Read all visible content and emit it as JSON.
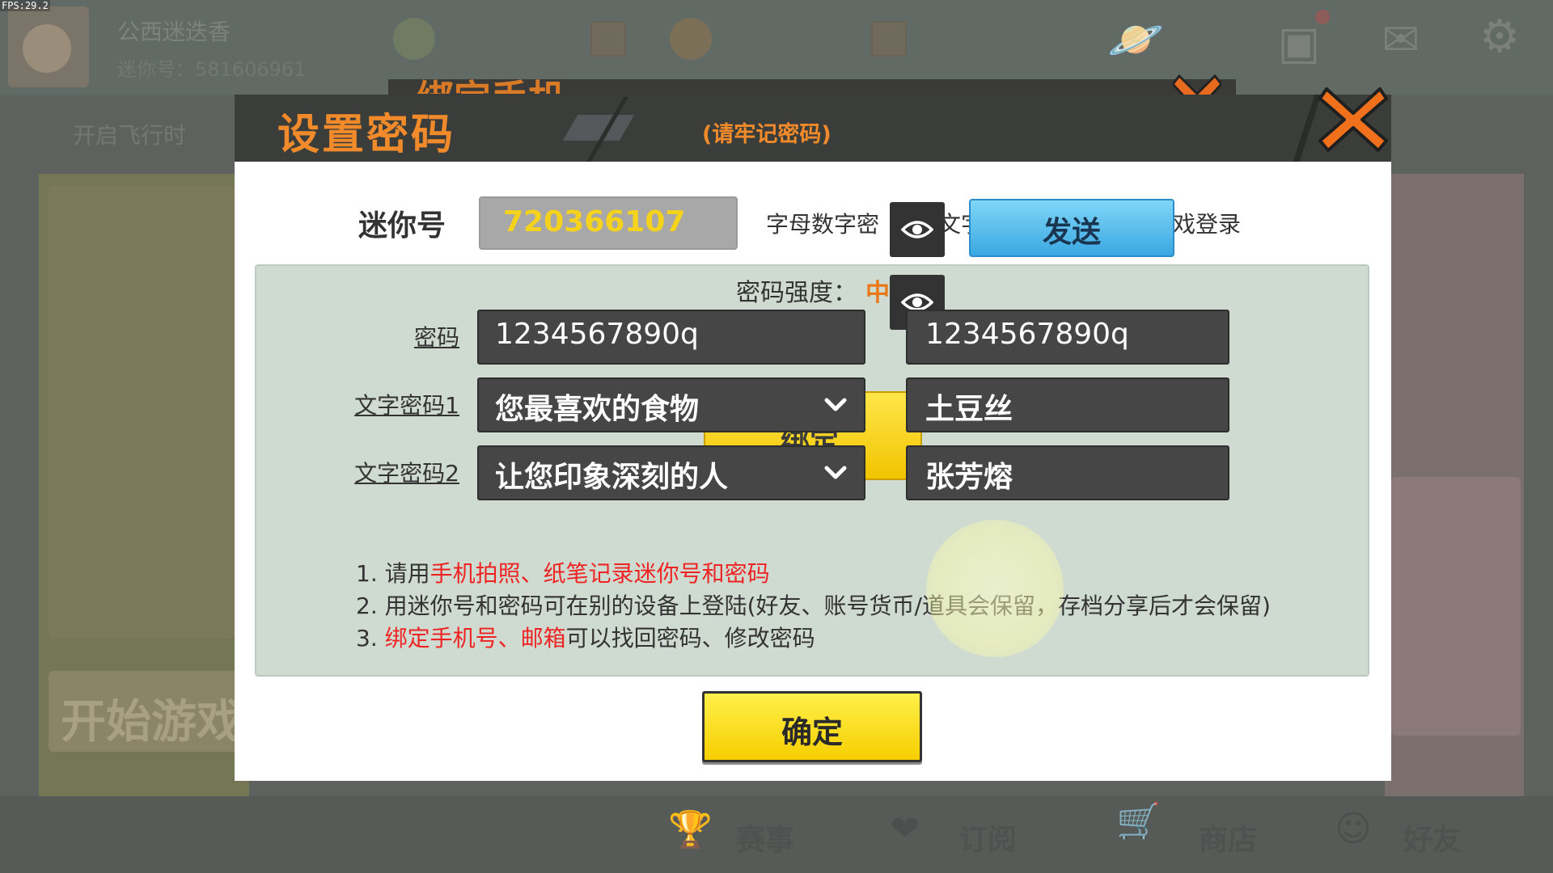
{
  "fps": "FPS:29.2",
  "background": {
    "player_name": "公西迷迭香",
    "player_id": "迷你号：581606961",
    "fly_text": "开启飞行时",
    "start_game": "开始游戏",
    "tabs": [
      {
        "label": "赛事",
        "icon": "trophy-icon"
      },
      {
        "label": "订阅",
        "icon": "subscribe-icon"
      },
      {
        "label": "商店",
        "icon": "shop-cart-icon"
      },
      {
        "label": "好友",
        "icon": "friends-icon"
      }
    ],
    "back_dialog_title": "绑定手机"
  },
  "dialog": {
    "title": "设置密码",
    "subtitle": "(请牢记密码)",
    "mini_label": "迷你号",
    "mini_value": "720366107",
    "option_text_left": "字母数字密",
    "option_text_mid": "文字",
    "option_text_right": "戏登录",
    "send_label": "发送",
    "strength_label": "密码强度：",
    "strength_value": "中",
    "password_label": "密码",
    "password_value": "1234567890q",
    "password_confirm_value": "1234567890q",
    "text_pwd1_label": "文字密码1",
    "text_pwd1_question": "您最喜欢的食物",
    "text_pwd1_answer": "土豆丝",
    "text_pwd2_label": "文字密码2",
    "text_pwd2_question": "让您印象深刻的人",
    "text_pwd2_answer": "张芳熔",
    "behind_button_label": "绑定",
    "notes": {
      "n1_prefix": "1. 请用",
      "n1_red": "手机拍照、纸笔记录迷你号和密码",
      "n2": "2. 用迷你号和密码可在别的设备上登陆(好友、账号货币/道具会保留，存档分享后才会保留)",
      "n3_prefix": "3. ",
      "n3_red": "绑定手机号、邮箱",
      "n3_suffix": "可以找回密码、修改密码"
    },
    "confirm_label": "确定"
  },
  "colors": {
    "accent_orange": "#f08a2b",
    "send_blue": "#3aa8e2",
    "confirm_yellow": "#f6cf00",
    "note_red": "#ee2424"
  }
}
